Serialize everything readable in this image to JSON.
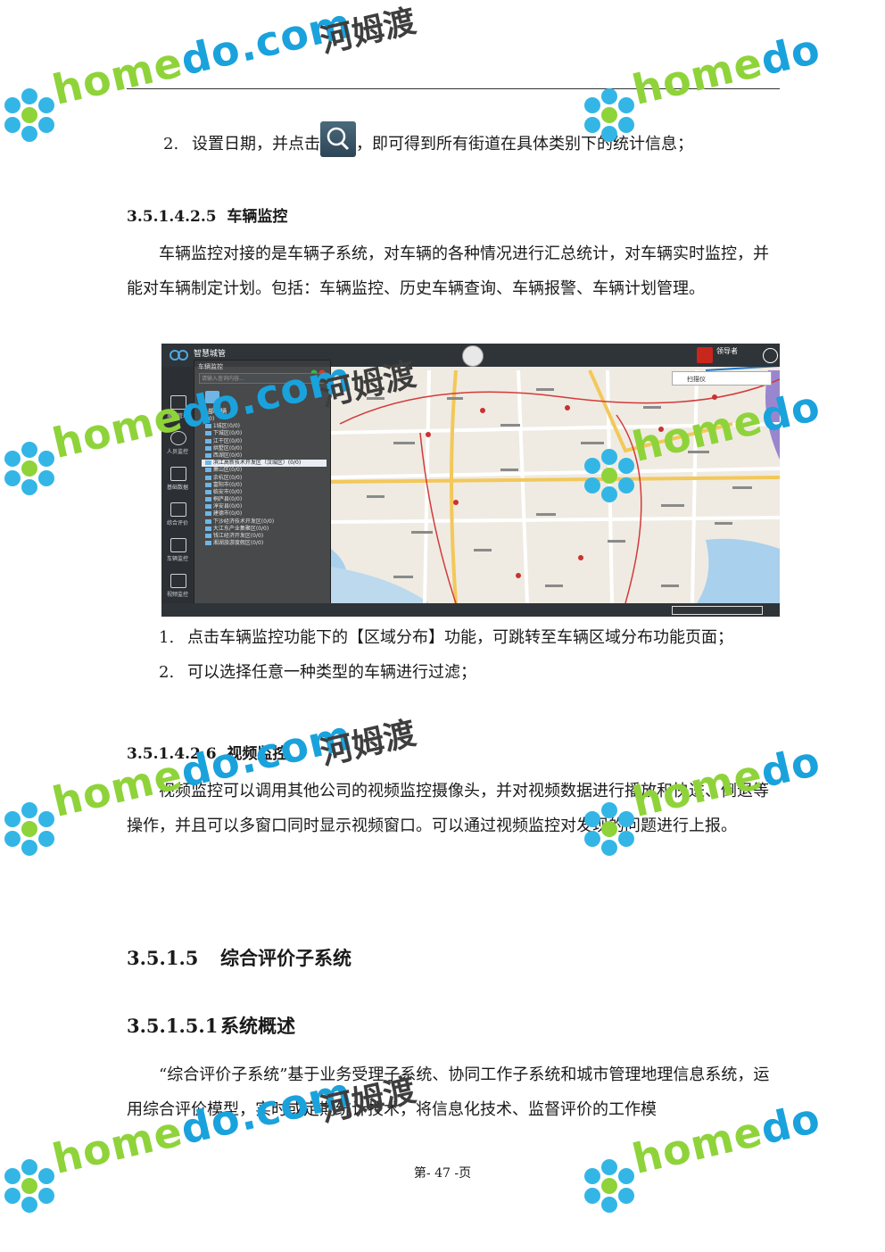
{
  "body": {
    "step2_prefix": "2.",
    "step2_before": "设置日期，并点击",
    "step2_after": "，即可得到所有街道在具体类别下的统计信息；",
    "sec_3_5_1_4_2_5": {
      "num": "3.5.1.4.2.5",
      "title": "车辆监控"
    },
    "para_vehicle": "车辆监控对接的是车辆子系统，对车辆的各种情况进行汇总统计，对车辆实时监控，并能对车辆制定计划。包括：车辆监控、历史车辆查询、车辆报警、车辆计划管理。",
    "vehicle_steps": [
      {
        "num": "1.",
        "text": "点击车辆监控功能下的【区域分布】功能，可跳转至车辆区域分布功能页面；"
      },
      {
        "num": "2.",
        "text": "可以选择任意一种类型的车辆进行过滤；"
      }
    ],
    "sec_3_5_1_4_2_6": {
      "num": "3.5.1.4.2.6",
      "title": "视频监控"
    },
    "para_video": "视频监控可以调用其他公司的视频监控摄像头，并对视频数据进行播放和快进、倒退等操作，并且可以多窗口同时显示视频窗口。可以通过视频监控对发现的问题进行上报。",
    "sec_3_5_1_5": {
      "num": "3.5.1.5",
      "title": "综合评价子系统"
    },
    "sec_3_5_1_5_1": {
      "num": "3.5.1.5.1",
      "title": "系统概述"
    },
    "para_overview": "“综合评价子系统”基于业务受理子系统、协同工作子系统和城市管理地理信息系统，运用综合评价模型，实时或定期统计技术，将信息化技术、监督评价的工作模",
    "footer": "第- 47 -页"
  },
  "screenshot": {
    "app_name": "智慧城管",
    "user": "领导者",
    "panel_title": "车辆监控",
    "search_placeholder": "请输入查询内容...",
    "all_vehicles": "全部车辆",
    "tree_root": "(0/0)",
    "tree_items": [
      "1城区(0/0)",
      "下城区(0/0)",
      "江干区(0/0)",
      "拱墅区(0/0)",
      "西湖区(0/0)",
      "滨江高新技术开发区（汉城区）(0/0)",
      "萧山区(0/0)",
      "余杭区(0/0)",
      "富阳市(0/0)",
      "临安市(0/0)",
      "桐庐县(0/0)",
      "淳安县(0/0)",
      "建德市(0/0)",
      "下沙经济技术开发区(0/0)",
      "大江东产业集聚区(0/0)",
      "钱江经济开发区(0/0)",
      "湘湖旅游度假区(0/0)"
    ],
    "map_search": "扫描仪",
    "nav_items": [
      "案件管理",
      "人员监控",
      "基础数据",
      "综合评价",
      "车辆监控",
      "视频监控"
    ]
  },
  "watermark": {
    "brand_a": "home",
    "brand_b": "do",
    "brand_c": ".com",
    "brand_cn": "河姆渡"
  },
  "colors": {
    "brand_green": "#8fd33a",
    "brand_blue": "#1aa2dc"
  }
}
